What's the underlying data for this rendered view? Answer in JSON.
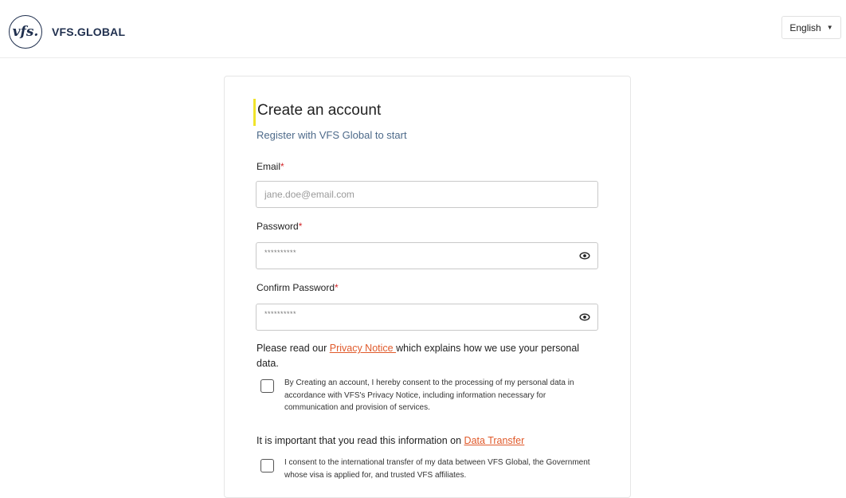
{
  "header": {
    "logo_mark": "vfs.",
    "logo_text": "VFS.GLOBAL",
    "language": "English"
  },
  "form": {
    "title": "Create an account",
    "subtitle": "Register with VFS Global to start",
    "email": {
      "label": "Email",
      "required_mark": "*",
      "placeholder": "jane.doe@email.com",
      "value": ""
    },
    "password": {
      "label": "Password",
      "required_mark": "*",
      "masked_value": "**********"
    },
    "confirm_password": {
      "label": "Confirm Password",
      "required_mark": "*",
      "masked_value": "**********"
    },
    "privacy": {
      "text_before": "Please read our ",
      "link": "Privacy Notice ",
      "text_after": "which explains how we use your personal data."
    },
    "consent_privacy": {
      "checked": false,
      "text": "By Creating an account, I hereby consent to the processing of my personal data in accordance with VFS's Privacy Notice, including information necessary for communication and provision of services."
    },
    "data_transfer": {
      "text_before": "It is important that you read this information on ",
      "link": "Data Transfer"
    },
    "consent_transfer": {
      "checked": false,
      "text": "I consent to the international transfer of my data between VFS Global, the Government whose visa is applied for, and trusted VFS affiliates."
    }
  },
  "colors": {
    "brand_navy": "#1f2f4e",
    "link_orange": "#e05a2b",
    "required_red": "#d3272a",
    "title_highlight": "#f0e32a",
    "subtitle_blue": "#4d6a8a"
  }
}
